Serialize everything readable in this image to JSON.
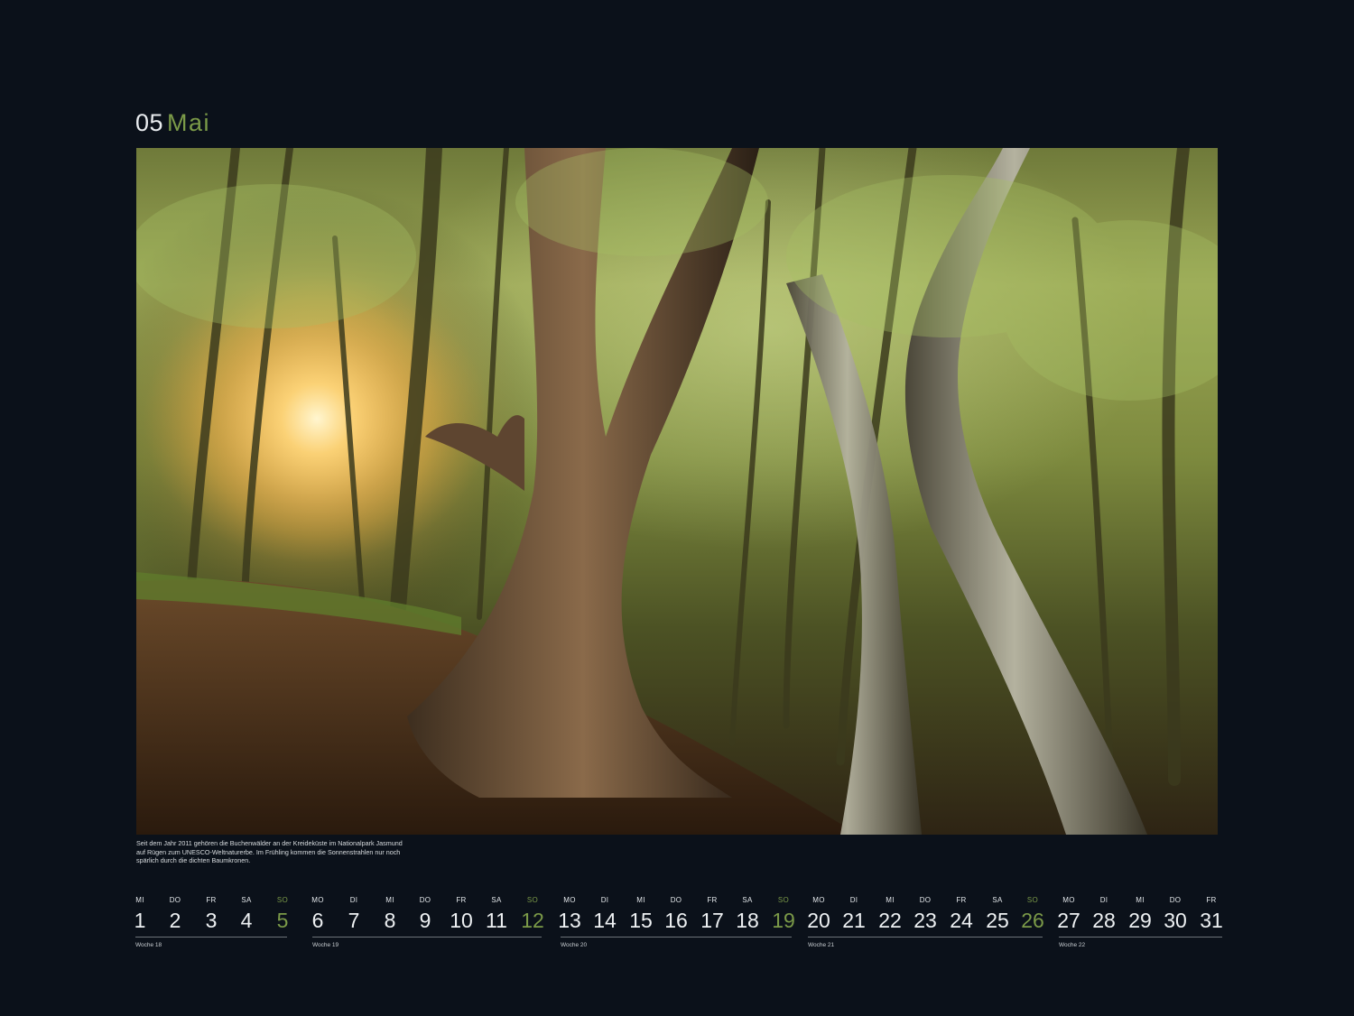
{
  "header": {
    "month_number": "05",
    "month_name": "Mai"
  },
  "photo": {
    "subject": "beech-forest-photo"
  },
  "caption": {
    "text": "Seit dem Jahr 2011 gehören die Buchenwälder an der Kreideküste im Nationalpark Jasmund auf Rügen zum UNESCO-Weltnaturerbe. Im Frühling kommen die Sonnenstrahlen nur noch spärlich durch die dichten Baumkronen."
  },
  "colors": {
    "background": "#0b111a",
    "accent": "#7b9a48",
    "text": "#e9ecef"
  },
  "days": [
    {
      "dow": "MI",
      "num": "1"
    },
    {
      "dow": "DO",
      "num": "2"
    },
    {
      "dow": "FR",
      "num": "3"
    },
    {
      "dow": "SA",
      "num": "4"
    },
    {
      "dow": "SO",
      "num": "5",
      "sunday": true
    },
    {
      "dow": "MO",
      "num": "6"
    },
    {
      "dow": "DI",
      "num": "7"
    },
    {
      "dow": "MI",
      "num": "8"
    },
    {
      "dow": "DO",
      "num": "9"
    },
    {
      "dow": "FR",
      "num": "10"
    },
    {
      "dow": "SA",
      "num": "11"
    },
    {
      "dow": "SO",
      "num": "12",
      "sunday": true
    },
    {
      "dow": "MO",
      "num": "13"
    },
    {
      "dow": "DI",
      "num": "14"
    },
    {
      "dow": "MI",
      "num": "15"
    },
    {
      "dow": "DO",
      "num": "16"
    },
    {
      "dow": "FR",
      "num": "17"
    },
    {
      "dow": "SA",
      "num": "18"
    },
    {
      "dow": "SO",
      "num": "19",
      "sunday": true
    },
    {
      "dow": "MO",
      "num": "20"
    },
    {
      "dow": "DI",
      "num": "21"
    },
    {
      "dow": "MI",
      "num": "22"
    },
    {
      "dow": "DO",
      "num": "23"
    },
    {
      "dow": "FR",
      "num": "24"
    },
    {
      "dow": "SA",
      "num": "25"
    },
    {
      "dow": "SO",
      "num": "26",
      "sunday": true
    },
    {
      "dow": "MO",
      "num": "27"
    },
    {
      "dow": "DI",
      "num": "28"
    },
    {
      "dow": "MI",
      "num": "29"
    },
    {
      "dow": "DO",
      "num": "30"
    },
    {
      "dow": "FR",
      "num": "31"
    }
  ],
  "weeks": [
    {
      "label": "Woche 18"
    },
    {
      "label": "Woche 19"
    },
    {
      "label": "Woche 20"
    },
    {
      "label": "Woche 21"
    },
    {
      "label": "Woche 22"
    }
  ]
}
